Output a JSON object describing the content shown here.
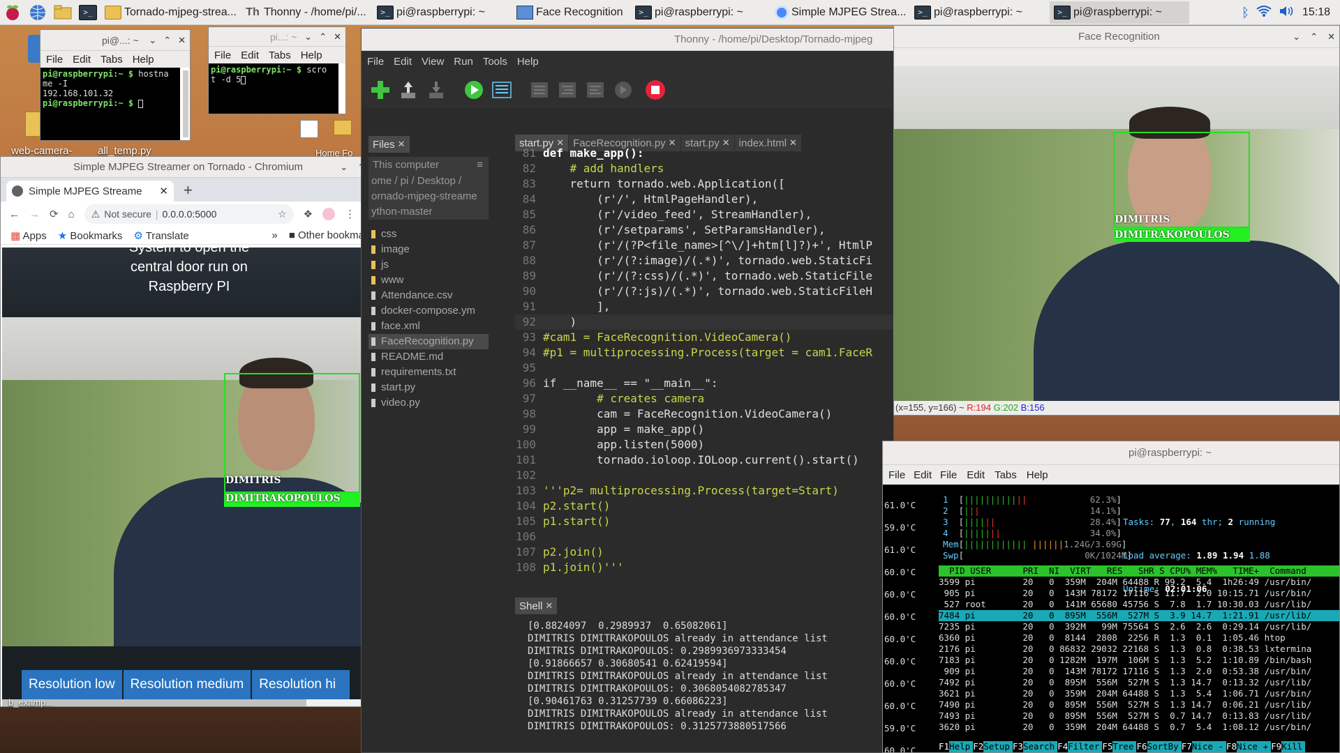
{
  "taskbar": {
    "tasks": [
      {
        "label": "Tornado-mjpeg-strea...",
        "icon": "folder-icon"
      },
      {
        "label": "Thonny  - /home/pi/...",
        "icon": "thonny-icon"
      },
      {
        "label": "pi@raspberrypi: ~",
        "icon": "terminal-icon"
      },
      {
        "label": "Face Recognition",
        "icon": "window-icon"
      },
      {
        "label": "pi@raspberrypi: ~",
        "icon": "terminal-icon"
      },
      {
        "label": "Simple MJPEG Strea...",
        "icon": "chromium-icon"
      },
      {
        "label": "pi@raspberrypi: ~",
        "icon": "terminal-icon"
      },
      {
        "label": "pi@raspberrypi: ~",
        "icon": "terminal-icon"
      }
    ],
    "clock": "15:18"
  },
  "desktop": {
    "icons": [
      "web-camera-",
      "all_temp.py",
      "Home Fo"
    ]
  },
  "term1": {
    "title": "pi@...: ~",
    "menu": [
      "File",
      "Edit",
      "Tabs",
      "Help"
    ],
    "lines": [
      {
        "prompt": "pi@raspberrypi:~ $ ",
        "text": "hostna"
      },
      {
        "prompt": "",
        "text": "me -I"
      },
      {
        "prompt": "",
        "text": "192.168.101.32"
      },
      {
        "prompt": "pi@raspberrypi:~ $ ",
        "text": ""
      }
    ]
  },
  "term2": {
    "title": "pi...: ~",
    "menu": [
      "File",
      "Edit",
      "Tabs",
      "Help"
    ],
    "lines": [
      {
        "prompt": "pi@raspberrypi:~ $ ",
        "text": "scro"
      },
      {
        "prompt": "",
        "text": "t -d 5"
      }
    ]
  },
  "chromium": {
    "title": "Simple MJPEG Streamer on Tornado - Chromium",
    "tab_label": "Simple MJPEG Streame",
    "security": "Not secure",
    "url": "0.0.0.0:5000",
    "bookmarks": [
      "Apps",
      "Bookmarks",
      "Translate"
    ],
    "other_bookmarks": "Other bookmarks",
    "page_heading_lines": [
      "System to open the",
      "central door run on",
      "Raspberry PI"
    ],
    "face_label_1": "DIMITRIS",
    "face_label_2": "DIMITRAKOPOULOS",
    "buttons": [
      "Resolution low",
      "Resolution medium",
      "Resolution hi"
    ],
    "status_fragment": "b_examp..."
  },
  "thonny": {
    "title": "Thonny  -  /home/pi/Desktop/Tornado-mjpeg",
    "menu": [
      "File",
      "Edit",
      "View",
      "Run",
      "Tools",
      "Help"
    ],
    "files_tab": "Files",
    "files_header": "This computer",
    "files_path": [
      "ome / pi / Desktop /",
      "ornado-mjpeg-streame",
      "ython-master"
    ],
    "files": [
      "css",
      "image",
      "js",
      "www",
      "Attendance.csv",
      "docker-compose.ym",
      "face.xml",
      "FaceRecognition.py",
      "README.md",
      "requirements.txt",
      "start.py",
      "video.py"
    ],
    "selected_file": "FaceRecognition.py",
    "editor_tabs": [
      "start.py",
      "FaceRecognition.py",
      "start.py",
      "index.html"
    ],
    "code": [
      {
        "n": "81",
        "t": "def make_app():",
        "c": "kw"
      },
      {
        "n": "82",
        "t": "    # add handlers",
        "c": "cm"
      },
      {
        "n": "83",
        "t": "    return tornado.web.Application([",
        "c": "plain"
      },
      {
        "n": "84",
        "t": "        (r'/', HtmlPageHandler),",
        "c": "plain"
      },
      {
        "n": "85",
        "t": "        (r'/video_feed', StreamHandler),",
        "c": "plain"
      },
      {
        "n": "86",
        "t": "        (r'/setparams', SetParamsHandler),",
        "c": "plain"
      },
      {
        "n": "87",
        "t": "        (r'/(?P<file_name>[^\\/]+htm[l]?)+', HtmlP",
        "c": "plain"
      },
      {
        "n": "88",
        "t": "        (r'/(?:image)/(.*)', tornado.web.StaticFi",
        "c": "plain"
      },
      {
        "n": "89",
        "t": "        (r'/(?:css)/(.*)', tornado.web.StaticFile",
        "c": "plain"
      },
      {
        "n": "90",
        "t": "        (r'/(?:js)/(.*)', tornado.web.StaticFileH",
        "c": "plain"
      },
      {
        "n": "91",
        "t": "        ],",
        "c": "plain"
      },
      {
        "n": "92",
        "t": "    )",
        "c": "plain"
      },
      {
        "n": "93",
        "t": "#cam1 = FaceRecognition.VideoCamera()",
        "c": "cm"
      },
      {
        "n": "94",
        "t": "#p1 = multiprocessing.Process(target = cam1.FaceR",
        "c": "cm"
      },
      {
        "n": "95",
        "t": "",
        "c": "plain"
      },
      {
        "n": "96",
        "t": "if __name__ == \"__main__\":",
        "c": "plain"
      },
      {
        "n": "97",
        "t": "        # creates camera",
        "c": "cm"
      },
      {
        "n": "98",
        "t": "        cam = FaceRecognition.VideoCamera()",
        "c": "plain"
      },
      {
        "n": "99",
        "t": "        app = make_app()",
        "c": "plain"
      },
      {
        "n": "100",
        "t": "        app.listen(5000)",
        "c": "plain"
      },
      {
        "n": "101",
        "t": "        tornado.ioloop.IOLoop.current().start()",
        "c": "plain"
      },
      {
        "n": "102",
        "t": "",
        "c": "plain"
      },
      {
        "n": "103",
        "t": "'''p2= multiprocessing.Process(target=Start)",
        "c": "cm"
      },
      {
        "n": "104",
        "t": "p2.start()",
        "c": "cm"
      },
      {
        "n": "105",
        "t": "p1.start()",
        "c": "cm"
      },
      {
        "n": "106",
        "t": "",
        "c": "cm"
      },
      {
        "n": "107",
        "t": "p2.join()",
        "c": "cm"
      },
      {
        "n": "108",
        "t": "p1.join()'''",
        "c": "cm"
      }
    ],
    "shell_tab": "Shell",
    "shell": [
      "[0.8824097  0.2989937  0.65082061]",
      "DIMITRIS DIMITRAKOPOULOS already in attendance list",
      "DIMITRIS DIMITRAKOPOULOS: 0.2989936973333454",
      "[0.91866657 0.30680541 0.62419594]",
      "DIMITRIS DIMITRAKOPOULOS already in attendance list",
      "DIMITRIS DIMITRAKOPOULOS: 0.3068054082785347",
      "[0.90461763 0.31257739 0.66086223]",
      "DIMITRIS DIMITRAKOPOULOS already in attendance list",
      "DIMITRIS DIMITRAKOPOULOS: 0.3125773880517566"
    ]
  },
  "facewin": {
    "title": "Face Recognition",
    "label_1": "DIMITRIS",
    "label_2": "DIMITRAKOPOULOS",
    "status": "(x=155, y=166) ~ ",
    "r": "R:194",
    "g": "G:202",
    "b": "B:156"
  },
  "htopwin": {
    "title": "pi@raspberrypi: ~",
    "menu_left": [
      "File",
      "Edit"
    ],
    "menu": [
      "File",
      "Edit",
      "Tabs",
      "Help"
    ],
    "temps": [
      "61.0'C",
      "59.0'C",
      "61.0'C",
      "60.0'C",
      "60.0'C",
      "60.0'C",
      "60.0'C",
      "60.0'C",
      "60.0'C",
      "60.0'C",
      "59.0'C",
      "60.0'C"
    ],
    "cpu_bars": [
      {
        "n": "1",
        "pct": "62.3%"
      },
      {
        "n": "2",
        "pct": "14.1%"
      },
      {
        "n": "3",
        "pct": "28.4%"
      },
      {
        "n": "4",
        "pct": "34.0%"
      }
    ],
    "mem": "1.24G/3.69G",
    "swp": "0K/1024M",
    "tasks_label": "Tasks: ",
    "tasks": "77",
    "thr": "164",
    "running": "2",
    "load_label": "Load average: ",
    "load": [
      "1.89",
      "1.94",
      "1.88"
    ],
    "uptime_label": "Uptime: ",
    "uptime": "02:01:06",
    "header": "  PID USER      PRI  NI  VIRT   RES   SHR S CPU% MEM%   TIME+  Command",
    "procs": [
      "3599 pi         20   0  359M  204M 64488 R 99.2  5.4  1h26:49 /usr/bin/",
      " 905 pi         20   0  143M 78172 17116 S 11.7  2.0 10:15.71 /usr/bin/",
      " 527 root       20   0  141M 65680 45756 S  7.8  1.7 10:30.03 /usr/lib/",
      "7484 pi         20   0  895M  556M  527M S  3.9 14.7  1:21.91 /usr/lib/",
      "7235 pi         20   0  392M   99M 75564 S  2.6  2.6  0:29.14 /usr/lib/",
      "6360 pi         20   0  8144  2808  2256 R  1.3  0.1  1:05.46 htop",
      "2176 pi         20   0 86832 29032 22168 S  1.3  0.8  0:38.53 lxtermina",
      "7183 pi         20   0 1282M  197M  106M S  1.3  5.2  1:10.89 /bin/bash",
      " 909 pi         20   0  143M 78172 17116 S  1.3  2.0  0:53.38 /usr/bin/",
      "7492 pi         20   0  895M  556M  527M S  1.3 14.7  0:13.32 /usr/lib/",
      "3621 pi         20   0  359M  204M 64488 S  1.3  5.4  1:06.71 /usr/bin/",
      "7490 pi         20   0  895M  556M  527M S  1.3 14.7  0:06.21 /usr/lib/",
      "7493 pi         20   0  895M  556M  527M S  0.7 14.7  0:13.83 /usr/lib/",
      "3620 pi         20   0  359M  204M 64488 S  0.7  5.4  1:08.12 /usr/bin/"
    ],
    "fkeys": [
      {
        "k": "F1",
        "l": "Help"
      },
      {
        "k": "F2",
        "l": "Setup"
      },
      {
        "k": "F3",
        "l": "Search"
      },
      {
        "k": "F4",
        "l": "Filter"
      },
      {
        "k": "F5",
        "l": "Tree"
      },
      {
        "k": "F6",
        "l": "SortBy"
      },
      {
        "k": "F7",
        "l": "Nice -"
      },
      {
        "k": "F8",
        "l": "Nice +"
      },
      {
        "k": "F9",
        "l": "Kill"
      }
    ]
  }
}
